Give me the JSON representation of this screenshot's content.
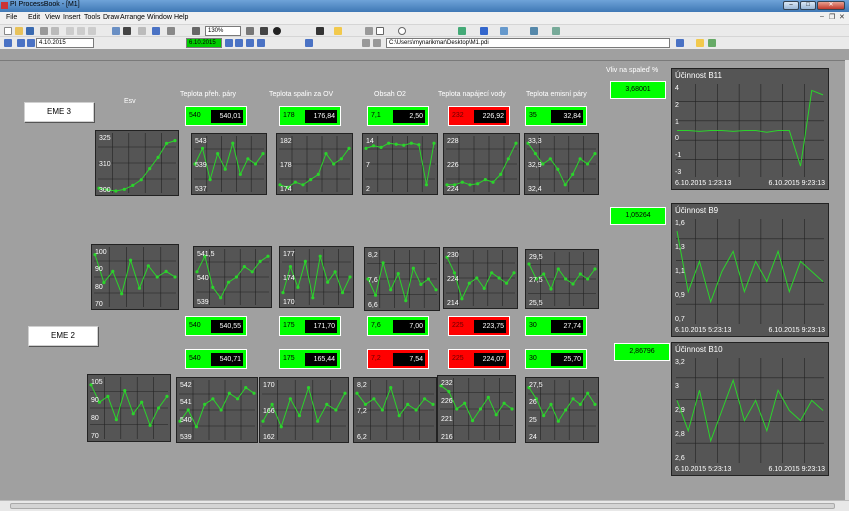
{
  "app": {
    "title": "PI ProcessBook - [M1]"
  },
  "menu": [
    "File",
    "Edit",
    "View",
    "Insert",
    "Tools",
    "Draw",
    "Arrange",
    "Window",
    "Help"
  ],
  "toolbar": {
    "zoom": "130%",
    "date_start": "4.10.2015",
    "date_end": "6.10.2015",
    "path": "C:\\Users\\mynarikmar\\Desktop\\M1.pdi"
  },
  "labels": {
    "esv": "Esv",
    "h1": "Teplota přeh. páry",
    "h2": "Teplota spalin za OV",
    "h3": "Obsah O2",
    "h4": "Teplota napájecí vody",
    "h5": "Teplota emisní páry",
    "vliv": "Vliv na spaleď %"
  },
  "eme": [
    "EME 3",
    "EME 2"
  ],
  "rows": [
    [
      {
        "sp": "540",
        "pv": "540,01",
        "state": "ok"
      },
      {
        "sp": "178",
        "pv": "176,84",
        "state": "ok"
      },
      {
        "sp": "7,1",
        "pv": "2,50",
        "state": "ok"
      },
      {
        "sp": "232",
        "pv": "226,92",
        "state": "alarm"
      },
      {
        "sp": "35",
        "pv": "32,84",
        "state": "ok"
      }
    ],
    [
      {
        "sp": "540",
        "pv": "540,55",
        "state": "ok"
      },
      {
        "sp": "175",
        "pv": "171,70",
        "state": "ok"
      },
      {
        "sp": "7,6",
        "pv": "7,00",
        "state": "ok"
      },
      {
        "sp": "225",
        "pv": "223,75",
        "state": "alarm"
      },
      {
        "sp": "30",
        "pv": "27,74",
        "state": "ok"
      }
    ],
    [
      {
        "sp": "540",
        "pv": "540,71",
        "state": "ok"
      },
      {
        "sp": "175",
        "pv": "165,44",
        "state": "ok"
      },
      {
        "sp": "7,2",
        "pv": "7,54",
        "state": "alarm"
      },
      {
        "sp": "225",
        "pv": "224,07",
        "state": "alarm"
      },
      {
        "sp": "30",
        "pv": "25,70",
        "state": "ok"
      }
    ]
  ],
  "trends": [
    {
      "axis": [
        "325",
        "310",
        "300"
      ],
      "series": [
        0.05,
        0.02,
        0.0,
        0.03,
        0.1,
        0.2,
        0.4,
        0.6,
        0.85,
        0.9
      ]
    },
    {
      "axis": [
        "543",
        "539",
        "537"
      ],
      "series": [
        0.5,
        0.8,
        0.2,
        0.7,
        0.4,
        0.9,
        0.3,
        0.6,
        0.5,
        0.7
      ]
    },
    {
      "axis": [
        "182",
        "178",
        "174"
      ],
      "series": [
        0.1,
        0.05,
        0.15,
        0.1,
        0.2,
        0.3,
        0.7,
        0.5,
        0.6,
        0.8
      ]
    },
    {
      "axis": [
        "14",
        "7",
        "2"
      ],
      "series": [
        0.8,
        0.85,
        0.82,
        0.9,
        0.88,
        0.86,
        0.9,
        0.87,
        0.1,
        0.9
      ]
    },
    {
      "axis": [
        "228",
        "226",
        "224"
      ],
      "series": [
        0.1,
        0.1,
        0.15,
        0.1,
        0.12,
        0.2,
        0.15,
        0.3,
        0.6,
        0.9
      ]
    },
    {
      "axis": [
        "33,3",
        "32,9",
        "32,4"
      ],
      "series": [
        0.9,
        0.7,
        0.5,
        0.6,
        0.4,
        0.1,
        0.3,
        0.6,
        0.5,
        0.7
      ]
    },
    {
      "axis": [
        "100",
        "90",
        "80",
        "70"
      ],
      "series": [
        0.9,
        0.4,
        0.6,
        0.2,
        0.8,
        0.3,
        0.7,
        0.5,
        0.6,
        0.5
      ]
    },
    {
      "axis": [
        "541,5",
        "540",
        "539"
      ],
      "series": [
        0.6,
        0.9,
        0.3,
        0.1,
        0.4,
        0.5,
        0.7,
        0.6,
        0.8,
        0.9
      ]
    },
    {
      "axis": [
        "177",
        "174",
        "170"
      ],
      "series": [
        0.2,
        0.7,
        0.3,
        0.8,
        0.1,
        0.9,
        0.4,
        0.6,
        0.2,
        0.5
      ]
    },
    {
      "axis": [
        "8,2",
        "7,6",
        "6,6"
      ],
      "series": [
        0.5,
        0.2,
        0.8,
        0.3,
        0.6,
        0.1,
        0.7,
        0.4,
        0.5,
        0.3
      ]
    },
    {
      "axis": [
        "230",
        "224",
        "214"
      ],
      "series": [
        0.9,
        0.6,
        0.1,
        0.4,
        0.5,
        0.3,
        0.6,
        0.5,
        0.4,
        0.6
      ]
    },
    {
      "axis": [
        "29,5",
        "27,5",
        "25,5"
      ],
      "series": [
        0.8,
        0.5,
        0.6,
        0.3,
        0.7,
        0.5,
        0.4,
        0.6,
        0.5,
        0.7
      ]
    },
    {
      "axis": [
        "105",
        "90",
        "80",
        "70"
      ],
      "series": [
        0.9,
        0.6,
        0.7,
        0.3,
        0.8,
        0.4,
        0.6,
        0.2,
        0.5,
        0.7
      ]
    },
    {
      "axis": [
        "542",
        "541",
        "540",
        "539"
      ],
      "series": [
        0.3,
        0.5,
        0.2,
        0.6,
        0.7,
        0.5,
        0.8,
        0.7,
        0.9,
        0.8
      ]
    },
    {
      "axis": [
        "170",
        "166",
        "162"
      ],
      "series": [
        0.3,
        0.6,
        0.2,
        0.7,
        0.4,
        0.9,
        0.3,
        0.6,
        0.5,
        0.8
      ]
    },
    {
      "axis": [
        "8,2",
        "7,2",
        "6,2"
      ],
      "series": [
        0.8,
        0.6,
        0.7,
        0.5,
        0.9,
        0.4,
        0.6,
        0.5,
        0.7,
        0.6
      ]
    },
    {
      "axis": [
        "232",
        "226",
        "221",
        "216"
      ],
      "series": [
        0.9,
        0.8,
        0.5,
        0.6,
        0.3,
        0.5,
        0.7,
        0.4,
        0.6,
        0.5
      ]
    },
    {
      "axis": [
        "27,5",
        "26",
        "25",
        "24"
      ],
      "series": [
        0.9,
        0.7,
        0.4,
        0.6,
        0.3,
        0.5,
        0.7,
        0.6,
        0.8,
        0.6
      ]
    }
  ],
  "green_values": [
    "3,68001",
    "1,05264",
    "2,86796"
  ],
  "big_trends": [
    {
      "title": "Účinnost B11",
      "axis": [
        "4",
        "2",
        "1",
        "0",
        "-1",
        "-3"
      ],
      "t_start": "6.10.2015 1:23:13",
      "t_end": "6.10.2015 9:23:13",
      "series": [
        0.5,
        0.5,
        0.49,
        0.5,
        0.5,
        0.49,
        0.5,
        0.5,
        0.48,
        0.5,
        0.5,
        0.1,
        0.95,
        0.9
      ]
    },
    {
      "title": "Účinnost B9",
      "axis": [
        "1,6",
        "1,3",
        "1,1",
        "0,9",
        "0,7"
      ],
      "t_start": "6.10.2015 5:23:13",
      "t_end": "6.10.2015 9:23:13",
      "series": [
        0.9,
        0.3,
        0.6,
        0.2,
        0.5,
        0.7,
        0.3,
        0.6,
        0.4,
        0.7,
        0.3,
        0.6,
        0.5,
        0.4
      ]
    },
    {
      "title": "Účinnost B10",
      "axis": [
        "3,2",
        "3",
        "2,9",
        "2,8",
        "2,6"
      ],
      "t_start": "6.10.2015 5:23:13",
      "t_end": "6.10.2015 9:23:13",
      "series": [
        0.6,
        0.3,
        0.7,
        0.2,
        0.5,
        0.8,
        0.4,
        0.6,
        0.3,
        0.7,
        0.5,
        0.4,
        0.6,
        0.5
      ]
    }
  ]
}
